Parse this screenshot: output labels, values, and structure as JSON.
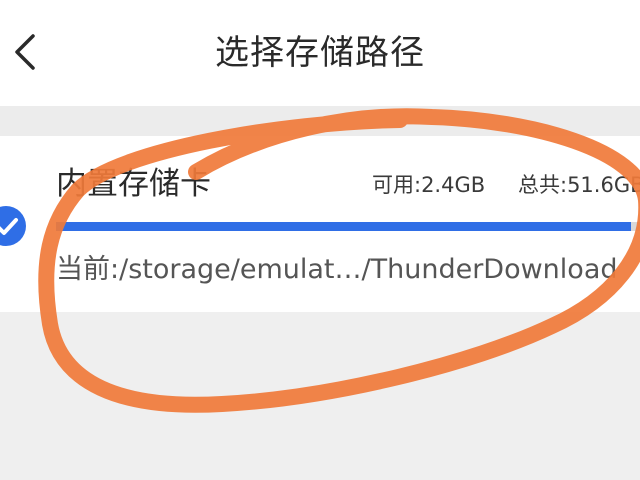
{
  "header": {
    "title": "选择存储路径",
    "back_icon": "chevron-left-icon"
  },
  "storage": {
    "name": "内置存储卡",
    "available": "可用:2.4GB",
    "total": "总共:51.6GB",
    "path": "当前:/storage/emulat…/ThunderDownload",
    "used_fraction": 0.985,
    "selected": true,
    "selected_icon": "check-circle-icon"
  },
  "colors": {
    "accent": "#2f6ee6",
    "annotation": "#f07a3a",
    "background": "#efefef",
    "card": "#ffffff"
  }
}
